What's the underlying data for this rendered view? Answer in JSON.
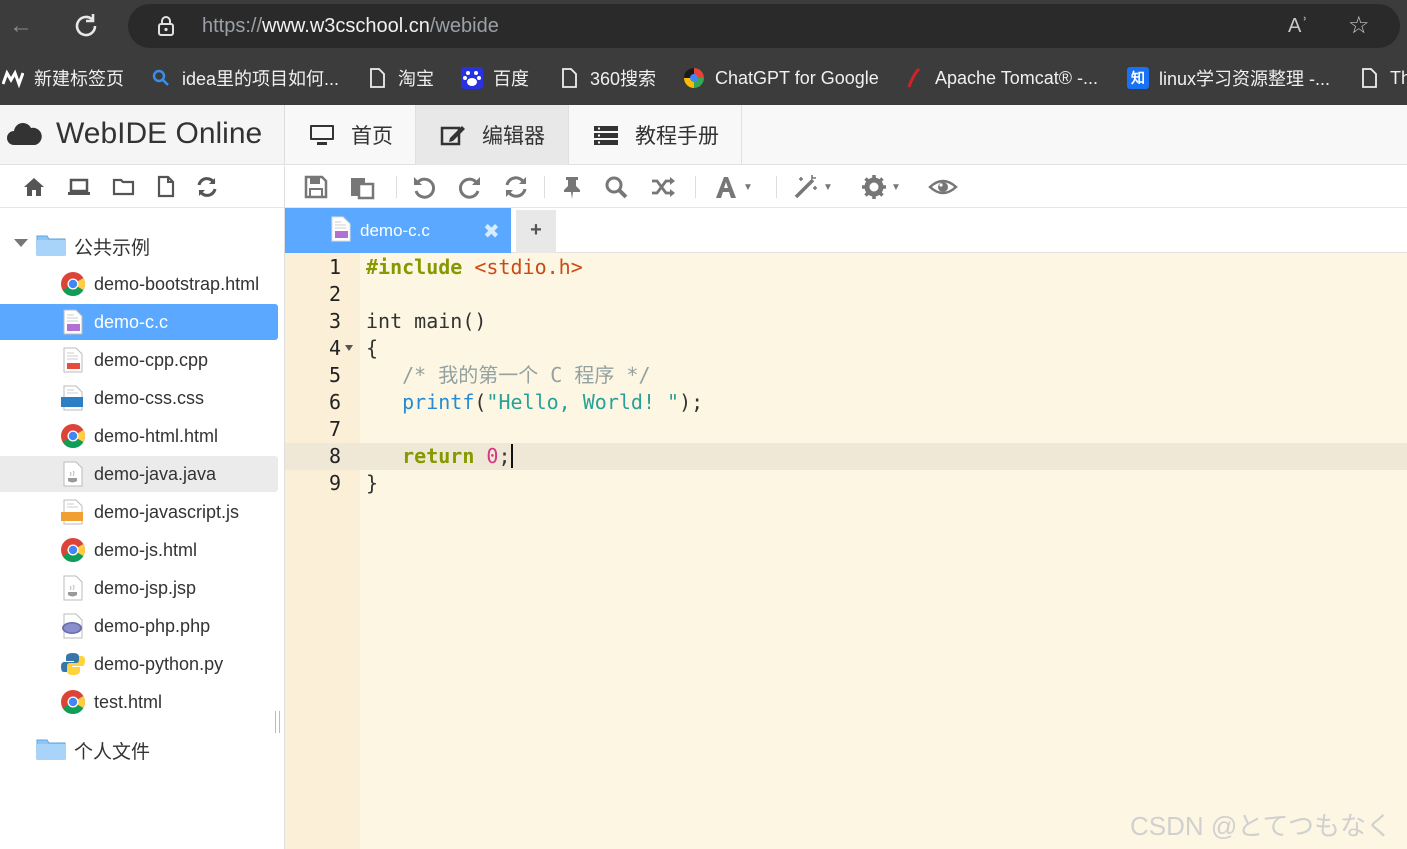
{
  "browser": {
    "url_prefix": "https://",
    "url_host": "www.w3cschool.cn",
    "url_path": "/webide",
    "read_aloud_label": "Aʾ",
    "bookmarks": [
      {
        "label": "新建标签页",
        "icon": "edge-new-tab-icon"
      },
      {
        "label": "idea里的项目如何...",
        "icon": "search-icon"
      },
      {
        "label": "淘宝",
        "icon": "page-icon"
      },
      {
        "label": "百度",
        "icon": "baidu-icon"
      },
      {
        "label": "360搜索",
        "icon": "page-icon"
      },
      {
        "label": "ChatGPT for Google",
        "icon": "chatgpt-icon"
      },
      {
        "label": "Apache Tomcat® -...",
        "icon": "tomcat-feather-icon"
      },
      {
        "label": "linux学习资源整理 -...",
        "icon": "zhihu-icon"
      },
      {
        "label": "Th",
        "icon": "page-icon"
      }
    ],
    "zhihu_glyph": "知"
  },
  "app": {
    "title": "WebIDE Online",
    "nav": [
      {
        "label": "首页",
        "icon": "monitor-icon",
        "active": false
      },
      {
        "label": "编辑器",
        "icon": "edit-icon",
        "active": true
      },
      {
        "label": "教程手册",
        "icon": "list-icon",
        "active": false
      }
    ]
  },
  "tree": {
    "public_folder": "公共示例",
    "personal_folder": "个人文件",
    "files": [
      {
        "name": "demo-bootstrap.html",
        "icon": "chrome-icon"
      },
      {
        "name": "demo-c.c",
        "icon": "c-file-icon",
        "selected": true
      },
      {
        "name": "demo-cpp.cpp",
        "icon": "cpp-file-icon"
      },
      {
        "name": "demo-css.css",
        "icon": "css-file-icon"
      },
      {
        "name": "demo-html.html",
        "icon": "chrome-icon"
      },
      {
        "name": "demo-java.java",
        "icon": "java-file-icon",
        "hovered": true
      },
      {
        "name": "demo-javascript.js",
        "icon": "js-file-icon"
      },
      {
        "name": "demo-js.html",
        "icon": "chrome-icon"
      },
      {
        "name": "demo-jsp.jsp",
        "icon": "jsp-file-icon"
      },
      {
        "name": "demo-php.php",
        "icon": "php-file-icon"
      },
      {
        "name": "demo-python.py",
        "icon": "python-file-icon"
      },
      {
        "name": "test.html",
        "icon": "chrome-icon"
      }
    ]
  },
  "editor": {
    "tab_label": "demo-c.c",
    "tab_close": "✖",
    "add_tab": "+",
    "line_numbers": [
      "1",
      "2",
      "3",
      "4",
      "5",
      "6",
      "7",
      "8",
      "9"
    ],
    "code": {
      "l1_pre": "#include",
      "l1_inc": " <stdio.h>",
      "l3": "int main()",
      "l4": "{",
      "l5": "   /* 我的第一个 C 程序 */",
      "l6_fn": "   printf",
      "l6_p1": "(",
      "l6_str": "\"Hello, World! \"",
      "l6_p2": ");",
      "l8_ret": "   return",
      "l8_sp": " ",
      "l8_num": "0",
      "l8_end": ";",
      "l9": "}"
    },
    "active_line": 8
  },
  "colors": {
    "selection": "#5aa8ff",
    "editor_bg": "#fdf6e3",
    "gutter_bg": "#fbf0d7"
  },
  "watermark": "CSDN @とてつもなく"
}
